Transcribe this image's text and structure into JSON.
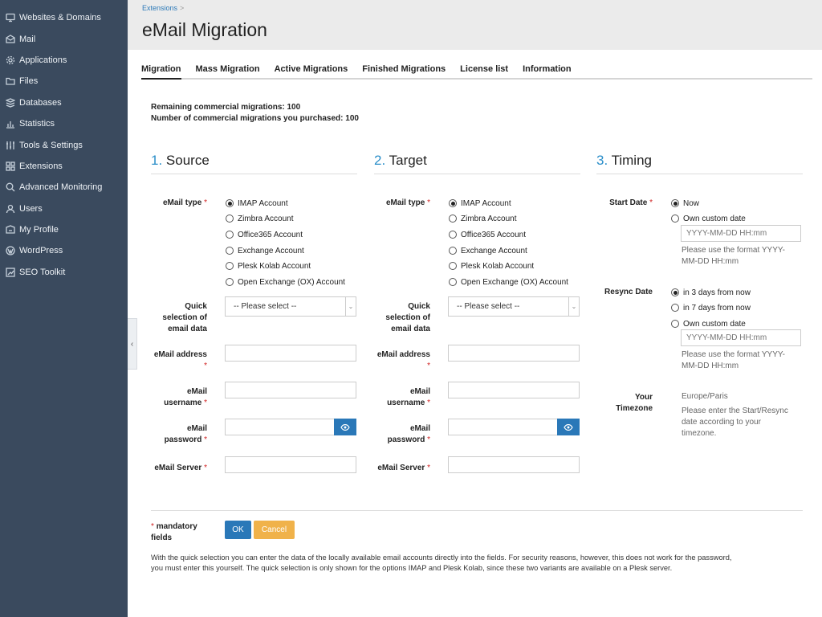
{
  "sidebar": {
    "items": [
      {
        "label": "Websites & Domains",
        "icon": "monitor-icon"
      },
      {
        "label": "Mail",
        "icon": "mail-icon"
      },
      {
        "label": "Applications",
        "icon": "gear-icon"
      },
      {
        "label": "Files",
        "icon": "folder-icon"
      },
      {
        "label": "Databases",
        "icon": "database-icon"
      },
      {
        "label": "Statistics",
        "icon": "bar-chart-icon"
      },
      {
        "label": "Tools & Settings",
        "icon": "sliders-icon"
      },
      {
        "label": "Extensions",
        "icon": "grid-icon"
      },
      {
        "label": "Advanced Monitoring",
        "icon": "magnifier-icon"
      },
      {
        "label": "Users",
        "icon": "user-icon"
      },
      {
        "label": "My Profile",
        "icon": "profile-icon"
      },
      {
        "label": "WordPress",
        "icon": "wordpress-icon"
      },
      {
        "label": "SEO Toolkit",
        "icon": "trend-icon"
      }
    ],
    "collapse_glyph": "‹"
  },
  "header": {
    "breadcrumb": "Extensions",
    "breadcrumb_sep": ">",
    "title": "eMail Migration"
  },
  "tabs": [
    "Migration",
    "Mass Migration",
    "Active Migrations",
    "Finished Migrations",
    "License list",
    "Information"
  ],
  "info": {
    "remaining": "Remaining commercial migrations: 100",
    "purchased": "Number of commercial migrations you purchased: 100"
  },
  "source": {
    "num": "1.",
    "title": "Source",
    "email_type_label": "eMail type",
    "options": [
      "IMAP Account",
      "Zimbra Account",
      "Office365 Account",
      "Exchange Account",
      "Plesk Kolab Account",
      "Open Exchange (OX) Account"
    ],
    "quick_label_1": "Quick",
    "quick_label_2": "selection of",
    "quick_label_3": "email data",
    "quick_value": "-- Please select --",
    "address_label": "eMail address",
    "username_label_1": "eMail",
    "username_label_2": "username",
    "password_label_1": "eMail",
    "password_label_2": "password",
    "server_label": "eMail Server"
  },
  "target": {
    "num": "2.",
    "title": "Target",
    "email_type_label": "eMail type",
    "options": [
      "IMAP Account",
      "Zimbra Account",
      "Office365 Account",
      "Exchange Account",
      "Plesk Kolab Account",
      "Open Exchange (OX) Account"
    ],
    "quick_label_1": "Quick",
    "quick_label_2": "selection of",
    "quick_label_3": "email data",
    "quick_value": "-- Please select --",
    "address_label": "eMail address",
    "username_label_1": "eMail",
    "username_label_2": "username",
    "password_label_1": "eMail",
    "password_label_2": "password",
    "server_label": "eMail Server"
  },
  "timing": {
    "num": "3.",
    "title": "Timing",
    "start_label": "Start Date",
    "start_now": "Now",
    "start_custom": "Own custom date",
    "date_placeholder": "YYYY-MM-DD HH:mm",
    "format_hint_1": "Please use the format YYYY-",
    "format_hint_2": "MM-DD HH:mm",
    "resync_label": "Resync Date",
    "resync_3": "in 3 days from now",
    "resync_7": "in 7 days from now",
    "resync_custom": "Own custom date",
    "tz_label_1": "Your",
    "tz_label_2": "Timezone",
    "tz_value": "Europe/Paris",
    "tz_hint_1": "Please enter the Start/Resync",
    "tz_hint_2": "date according to your",
    "tz_hint_3": "timezone."
  },
  "required_mark": "*",
  "footer": {
    "mandatory_1": "mandatory",
    "mandatory_2": "fields",
    "ok": "OK",
    "cancel": "Cancel",
    "note_1": "With the quick selection you can enter the data of the locally available email accounts directly into the fields. For security reasons, however, this does not work for the password,",
    "note_2": "you must enter this yourself. The quick selection is only shown for the options IMAP and Plesk Kolab, since these two variants are available on a Plesk server."
  },
  "colors": {
    "sidebar": "#3a4a5e",
    "accent": "#2a8ec9",
    "ok": "#2a78b8",
    "cancel": "#f0b24a"
  }
}
